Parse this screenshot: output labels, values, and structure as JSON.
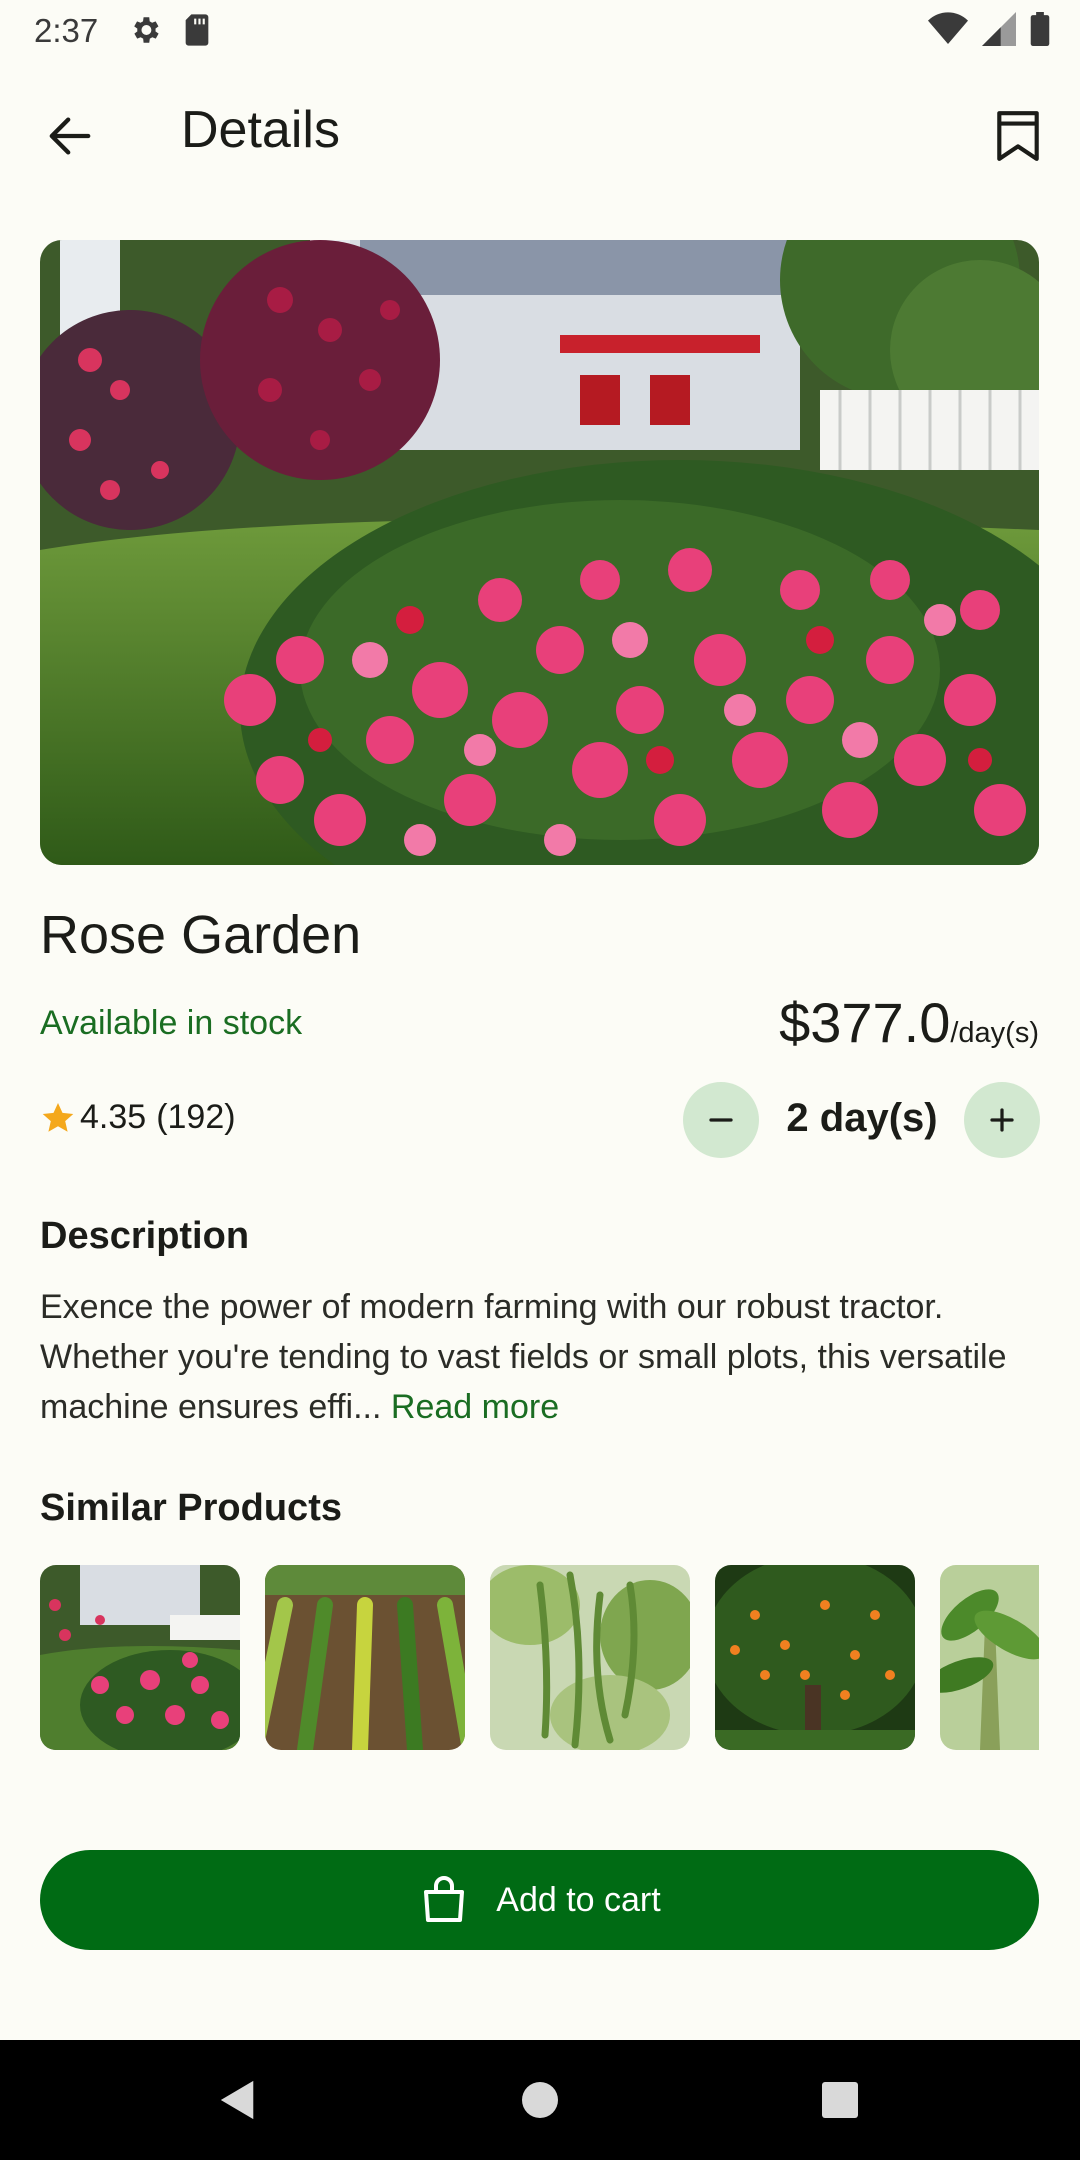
{
  "status_bar": {
    "time": "2:37"
  },
  "app_bar": {
    "title": "Details"
  },
  "product": {
    "name": "Rose Garden",
    "stock_status": "Available in stock",
    "price": "$377.0",
    "price_unit": "/day(s)",
    "rating": "4.35",
    "review_count": "(192)",
    "quantity": "2 day(s)"
  },
  "description": {
    "heading": "Description",
    "text": "Exence the power of modern farming with our robust tractor. Whether you're tending to vast fields or small plots, this versatile machine ensures effi...",
    "read_more": "Read more"
  },
  "similar": {
    "heading": "Similar Products",
    "items": [
      "rose-garden",
      "vegetable-rows",
      "green-beans",
      "orange-tree",
      "banana-plant"
    ]
  },
  "cart": {
    "label": "Add to cart"
  },
  "colors": {
    "primary": "#006b14",
    "accent_text": "#1a6d22",
    "qty_button_bg": "#d2e8d0",
    "star": "#f4a81c",
    "background": "#fcfcf6"
  }
}
